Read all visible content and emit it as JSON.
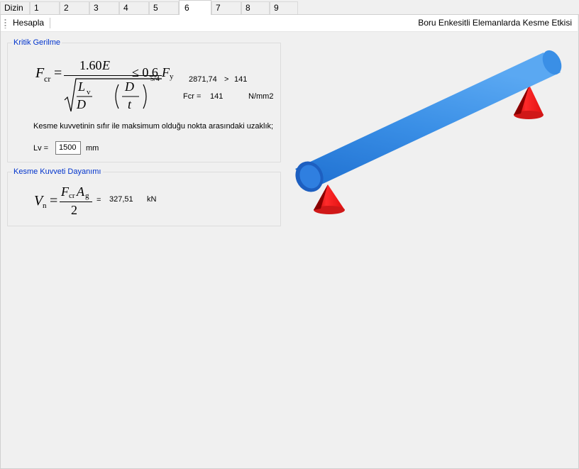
{
  "tabs": [
    {
      "label": "Dizin",
      "active": false
    },
    {
      "label": "1",
      "active": false
    },
    {
      "label": "2",
      "active": false
    },
    {
      "label": "3",
      "active": false
    },
    {
      "label": "4",
      "active": false
    },
    {
      "label": "5",
      "active": false
    },
    {
      "label": "6",
      "active": true
    },
    {
      "label": "7",
      "active": false
    },
    {
      "label": "8",
      "active": false
    },
    {
      "label": "9",
      "active": false
    }
  ],
  "toolbar": {
    "calculate_label": "Hesapla",
    "title": "Boru Enkesitli Elemanlarda Kesme Etkisi"
  },
  "critical_stress": {
    "legend": "Kritik Gerilme",
    "formula": {
      "lhs_symbol": "F",
      "lhs_sub": "cr",
      "coefficient": "1.60",
      "modulus": "E",
      "length_symbol": "L",
      "length_sub": "v",
      "diameter": "D",
      "thickness": "t",
      "exponent": "5/4",
      "comparison": "≤ 0.6",
      "yield_symbol": "F",
      "yield_sub": "y"
    },
    "computed_value": "2871,74",
    "comparison_op": ">",
    "limit_value": "141",
    "fcr_label": "Fcr =",
    "fcr_value": "141",
    "fcr_unit": "N/mm2",
    "distance_note": "Kesme kuvvetinin sıfır ile maksimum olduğu nokta arasındaki uzaklık;",
    "lv_label": "Lv =",
    "lv_value": "1500",
    "lv_unit": "mm"
  },
  "shear_strength": {
    "legend": "Kesme Kuvveti Dayanımı",
    "formula": {
      "lhs_symbol": "V",
      "lhs_sub": "n",
      "num_symbol": "F",
      "num_sub": "cr",
      "area_symbol": "A",
      "area_sub": "g",
      "denominator": "2"
    },
    "equals": "=",
    "value": "327,51",
    "unit": "kN"
  },
  "colors": {
    "pipe": "#3a8fe6",
    "support": "#e82020",
    "legend_text": "#0033cc"
  }
}
